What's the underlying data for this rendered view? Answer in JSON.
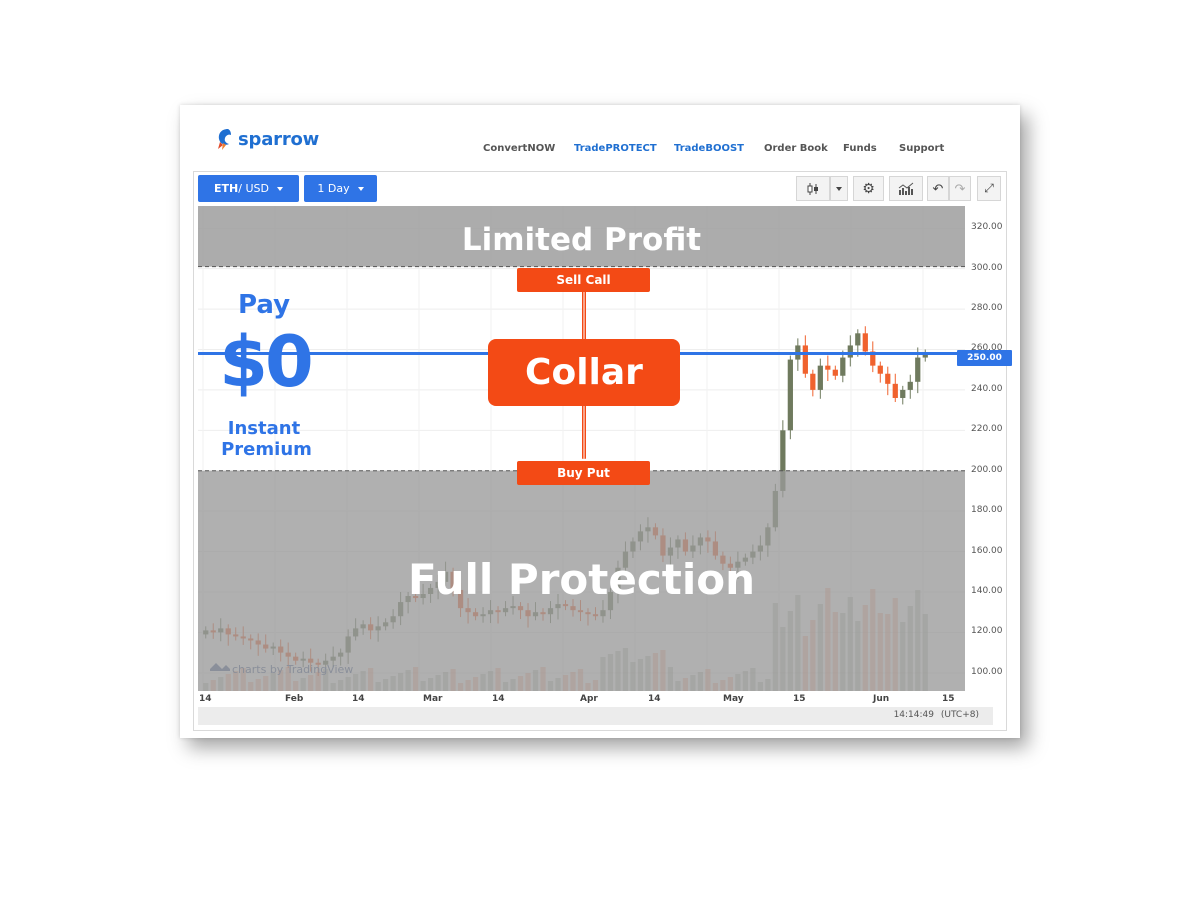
{
  "brand": {
    "name": "sparrow",
    "colors": {
      "blue": "#2f74e6",
      "orange": "#f34a15",
      "bull": "#6f7a5e",
      "bear": "#f0622e"
    }
  },
  "nav": {
    "items": [
      "ConvertNOW",
      "TradePROTECT",
      "TradeBOOST",
      "Order Book",
      "Funds",
      "Support"
    ],
    "active": [
      "TradePROTECT",
      "TradeBOOST"
    ]
  },
  "toolbar": {
    "pair_base": "ETH",
    "pair_quote": " / USD",
    "interval": "1 Day",
    "icons": [
      "candles-icon",
      "chevron-down-icon",
      "gear-icon",
      "indicators-icon",
      "undo-icon",
      "redo-icon",
      "fullscreen-icon"
    ]
  },
  "overlay": {
    "top_zone": "Limited Profit",
    "bottom_zone": "Full Protection",
    "sell_call": "Sell Call",
    "buy_put": "Buy Put",
    "strategy": "Collar",
    "pay": "Pay",
    "premium_amount": "$0",
    "premium_line1": "Instant",
    "premium_line2": "Premium"
  },
  "chart_data": {
    "type": "candlestick",
    "price_ticks": [
      "320.00",
      "300.00",
      "280.00",
      "260.00",
      "250.00",
      "240.00",
      "220.00",
      "200.00",
      "180.00",
      "160.00",
      "140.00",
      "120.00",
      "100.00"
    ],
    "current_price_label": "250.00",
    "current_price": 258,
    "sell_call_strike": 301,
    "buy_put_strike": 200,
    "date_ticks": [
      "14",
      "Feb",
      "14",
      "Mar",
      "14",
      "Apr",
      "14",
      "May",
      "15",
      "Jun",
      "15"
    ],
    "ylim": [
      91,
      331
    ],
    "watermark": "charts by TradingView",
    "closes": [
      121,
      120,
      122,
      119,
      118,
      117,
      116,
      114,
      112,
      113,
      110,
      108,
      106,
      107,
      105,
      104,
      106,
      108,
      110,
      118,
      122,
      124,
      121,
      123,
      125,
      128,
      135,
      138,
      137,
      139,
      142,
      145,
      150,
      141,
      132,
      130,
      128,
      129,
      131,
      130,
      132,
      133,
      131,
      128,
      130,
      129,
      132,
      134,
      133,
      131,
      130,
      129,
      128,
      131,
      140,
      152,
      160,
      165,
      170,
      172,
      168,
      158,
      162,
      166,
      160,
      163,
      167,
      165,
      158,
      154,
      152,
      155,
      157,
      160,
      163,
      172,
      190,
      220,
      255,
      262,
      248,
      240,
      252,
      250,
      247,
      256,
      262,
      268,
      259,
      252,
      248,
      243,
      236,
      240,
      244,
      256,
      258
    ]
  },
  "status": {
    "time": "14:14:49",
    "tz": "(UTC+8)"
  }
}
